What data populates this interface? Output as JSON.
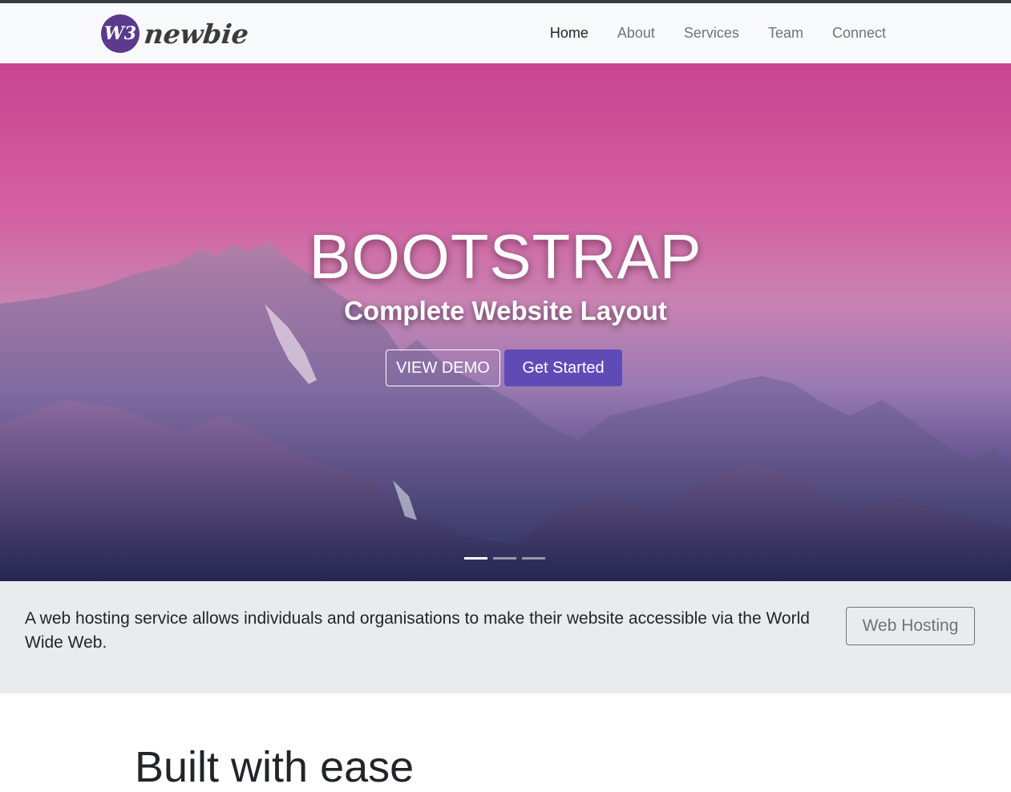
{
  "brand": {
    "logo_mark": "W3",
    "name": "newbie"
  },
  "nav": {
    "items": [
      {
        "label": "Home",
        "active": true
      },
      {
        "label": "About",
        "active": false
      },
      {
        "label": "Services",
        "active": false
      },
      {
        "label": "Team",
        "active": false
      },
      {
        "label": "Connect",
        "active": false
      }
    ]
  },
  "hero": {
    "title": "BOOTSTRAP",
    "subtitle": "Complete Website Layout",
    "demo_button": "VIEW DEMO",
    "start_button": "Get Started",
    "slide_count": 3,
    "active_slide": 1
  },
  "jumbotron": {
    "text": "A web hosting service allows individuals and organisations to make their website accessible via the World Wide Web.",
    "button": "Web Hosting"
  },
  "section": {
    "heading": "Built with ease"
  },
  "colors": {
    "accent": "#5f4bb6",
    "brand": "#5b3a8e",
    "nav_bg": "#f8f9fa",
    "jumbotron_bg": "#e9ecef",
    "hero_top": "#c84590",
    "hero_bottom": "#2c2d5c"
  }
}
